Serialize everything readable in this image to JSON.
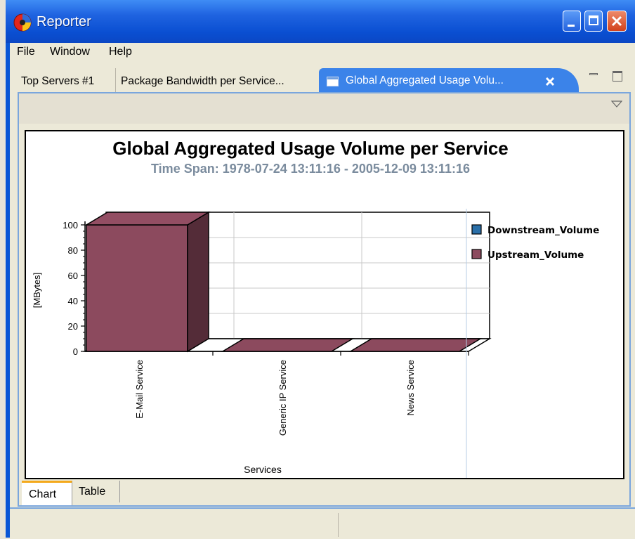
{
  "window": {
    "title": "Reporter",
    "app_icon": "reporter-icon"
  },
  "controls": {
    "minimize": "minimize-icon",
    "maximize": "maximize-icon",
    "close": "close-icon"
  },
  "menu": [
    "File",
    "Window",
    "Help"
  ],
  "tabs": [
    {
      "label": "Top Servers #1",
      "active": false
    },
    {
      "label": "Package Bandwidth per Service...",
      "active": false
    },
    {
      "label": "Global Aggregated Usage Volu...",
      "active": true
    }
  ],
  "panel_controls": {
    "minimize": "minimize-view-icon",
    "maximize": "maximize-view-icon",
    "menu": "view-menu-icon"
  },
  "chart_data": {
    "type": "bar",
    "title": "Global Aggregated Usage Volume per Service",
    "subtitle": "Time Span: 1978-07-24 13:11:16 - 2005-12-09 13:11:16",
    "xlabel": "Services",
    "ylabel": "[MBytes]",
    "categories": [
      "E-Mail Service",
      "Generic IP Service",
      "News Service"
    ],
    "series": [
      {
        "name": "Downstream_Volume",
        "values": [
          0,
          0,
          0
        ],
        "color": "#2a6fa8"
      },
      {
        "name": "Upstream_Volume",
        "values": [
          100,
          0,
          0
        ],
        "color": "#8c4a5e"
      }
    ],
    "yticks": [
      "0",
      "20",
      "40",
      "60",
      "80",
      "100"
    ],
    "ylim": [
      0,
      100
    ],
    "grid": true,
    "legend": "right",
    "is3d": true
  },
  "bottom_tabs": [
    {
      "label": "Chart",
      "active": true
    },
    {
      "label": "Table",
      "active": false
    }
  ]
}
